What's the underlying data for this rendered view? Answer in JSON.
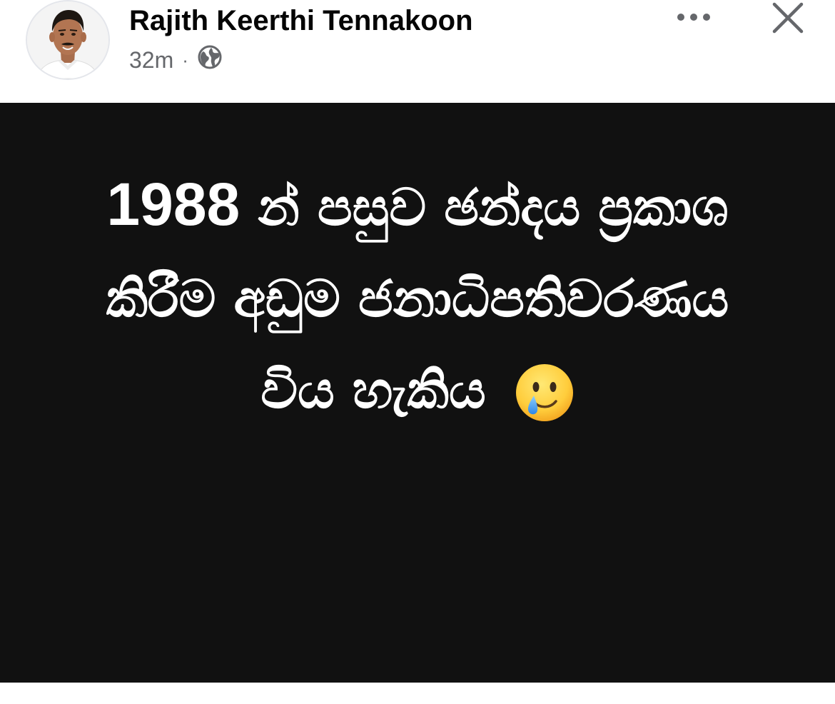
{
  "post": {
    "author_name": "Rajith Keerthi Tennakoon",
    "timestamp": "32m",
    "separator": "·",
    "privacy_icon": "globe-icon",
    "more_icon": "more-options-icon",
    "close_icon": "close-icon",
    "avatar_icon": "profile-photo"
  },
  "image": {
    "background_color": "#111111",
    "text_color": "#ffffff",
    "line1_year": "1988",
    "line1_rest": " න් පසුව ඡන්දය ප්‍රකාශ",
    "line2": "කිරීම අඩුම ජනාධිපතිවරණය",
    "line3": "විය හැකිය",
    "emoji": "face-holding-back-tears-emoji"
  },
  "colors": {
    "name_text": "#050505",
    "meta_text": "#65676b",
    "icon_gray": "#65676b"
  }
}
